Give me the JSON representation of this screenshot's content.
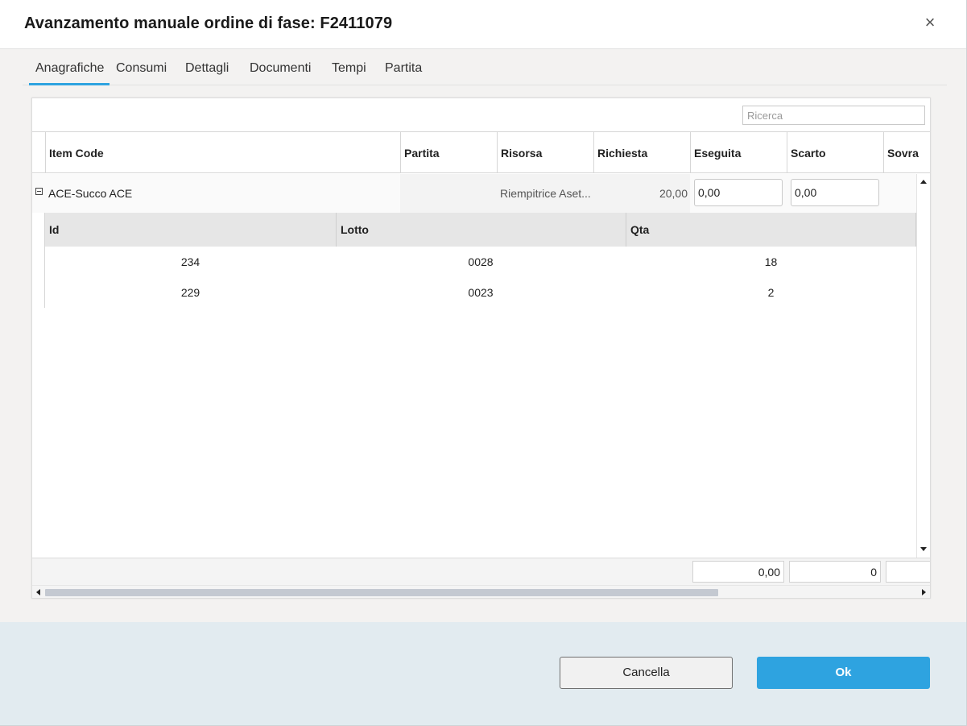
{
  "dialog": {
    "title": "Avanzamento manuale ordine di fase: F2411079",
    "close_glyph": "×"
  },
  "tabs": [
    {
      "label": "Anagrafiche",
      "active": true
    },
    {
      "label": "Consumi",
      "active": false
    },
    {
      "label": "Dettagli",
      "active": false
    },
    {
      "label": "Documenti",
      "active": false
    },
    {
      "label": "Tempi",
      "active": false
    },
    {
      "label": "Partita",
      "active": false
    }
  ],
  "search": {
    "placeholder": "Ricerca",
    "value": ""
  },
  "grid": {
    "columns": [
      "Item Code",
      "Partita",
      "Risorsa",
      "Richiesta",
      "Eseguita",
      "Scarto",
      "Sovra"
    ],
    "row": {
      "item_code": "ACE-Succo ACE",
      "partita": "",
      "risorsa": "Riempitrice Aset...",
      "richiesta": "20,00",
      "eseguita": "0,00",
      "scarto": "0,00"
    },
    "sub_columns": [
      "Id",
      "Lotto",
      "Qta"
    ],
    "sub_rows": [
      {
        "id": "234",
        "lotto": "0028",
        "qta": "18"
      },
      {
        "id": "229",
        "lotto": "0023",
        "qta": "2"
      }
    ],
    "footer": {
      "eseguita_total": "0,00",
      "scarto_total": "0",
      "sovra_total": ""
    }
  },
  "buttons": {
    "cancel": "Cancella",
    "ok": "Ok"
  },
  "colors": {
    "accent": "#2ea3e0",
    "footer_band": "#e2ebf0"
  }
}
